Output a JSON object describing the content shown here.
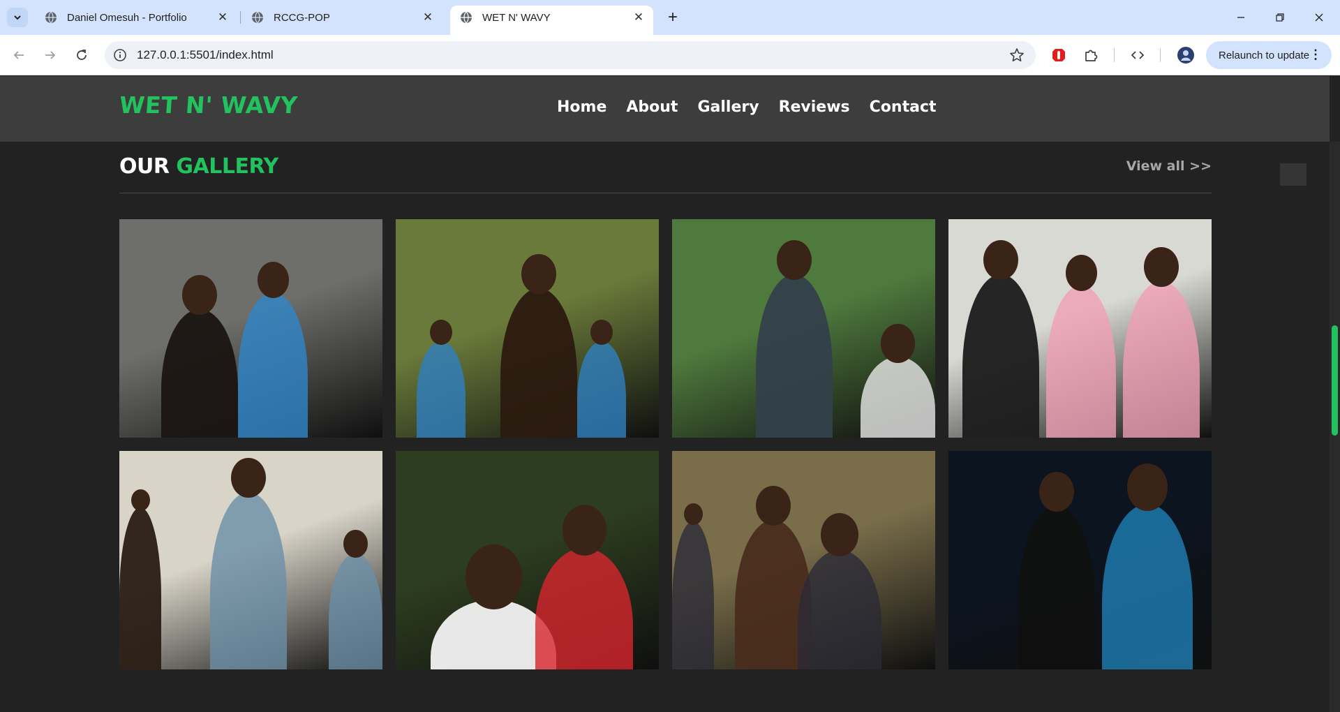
{
  "browser": {
    "tabs": [
      {
        "title": "Daniel Omesuh - Portfolio",
        "active": false
      },
      {
        "title": "RCCG-POP",
        "active": false
      },
      {
        "title": "WET N' WAVY",
        "active": true
      }
    ],
    "url": "127.0.0.1:5501/index.html",
    "relaunch_label": "Relaunch to update"
  },
  "site": {
    "logo": "WET N' WAVY",
    "nav": [
      "Home",
      "About",
      "Gallery",
      "Reviews",
      "Contact"
    ],
    "gallery": {
      "title_white": "OUR",
      "title_green": "GALLERY",
      "view_all": "View all >>"
    },
    "photos": [
      {
        "name": "gallery-photo-1",
        "bg": "#6e6e6a",
        "accent": "#2f86c9",
        "figure": "#1a1412"
      },
      {
        "name": "gallery-photo-2",
        "bg": "#6a7a3a",
        "accent": "#2e7fc1",
        "figure": "#2b1a10"
      },
      {
        "name": "gallery-photo-3",
        "bg": "#4f7a3d",
        "accent": "#e8e8e8",
        "figure": "#33404a"
      },
      {
        "name": "gallery-photo-4",
        "bg": "#d9d9d4",
        "accent": "#ef9fb4",
        "figure": "#1b1b1b"
      },
      {
        "name": "gallery-photo-5",
        "bg": "#d8d4c8",
        "accent": "#6a8ea6",
        "figure": "#2a1c14"
      },
      {
        "name": "gallery-photo-6",
        "bg": "#2d3d1f",
        "accent": "#d7262d",
        "figure": "#f2f2f2"
      },
      {
        "name": "gallery-photo-7",
        "bg": "#7a6e4a",
        "accent": "#2a2a36",
        "figure": "#4a2c1c"
      },
      {
        "name": "gallery-photo-8",
        "bg": "#0c1420",
        "accent": "#1e7fb5",
        "figure": "#101010"
      }
    ]
  },
  "colors": {
    "accent_green": "#22c35e",
    "page_bg": "#222222",
    "nav_bg": "#3d3d3d"
  }
}
